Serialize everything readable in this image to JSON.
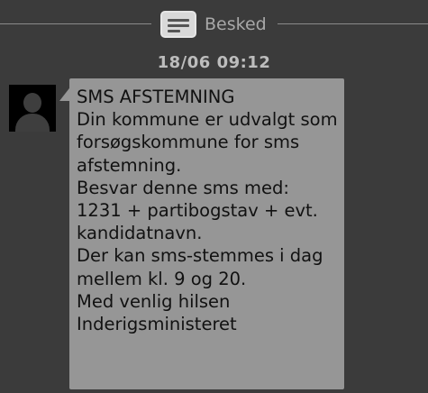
{
  "header": {
    "title": "Besked",
    "icon": "message-icon"
  },
  "conversation": {
    "timestamp": "18/06 09:12",
    "sender_avatar": "contact-avatar-icon",
    "message": {
      "lines": [
        "SMS AFSTEMNING",
        "Din kommune er udvalgt som",
        "forsøgskommune for sms",
        "afstemning.",
        "Besvar denne sms med:",
        "1231 + partibogstav + evt.",
        "kandidatnavn.",
        "Der kan sms-stemmes i dag",
        "mellem kl. 9 og 20.",
        "Med venlig hilsen",
        "Inderigsministeret"
      ]
    }
  },
  "colors": {
    "background": "#3b3b3b",
    "bubble": "#969696",
    "text": "#111111"
  }
}
